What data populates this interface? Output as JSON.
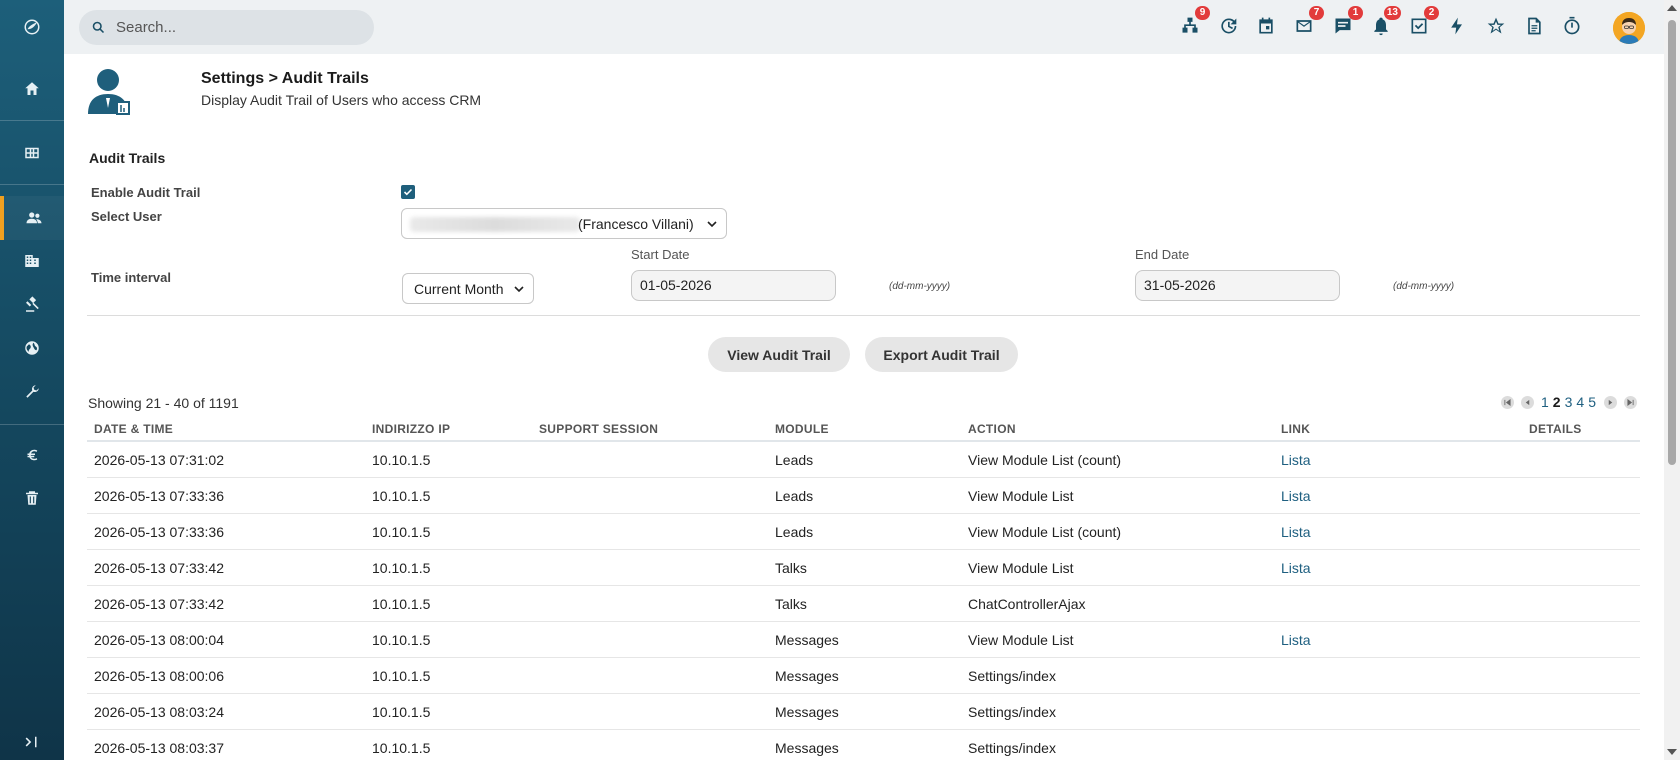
{
  "search": {
    "placeholder": "Search..."
  },
  "topbar": {
    "badges": {
      "structure": "9",
      "mail": "7",
      "chat": "1",
      "bell": "13",
      "tasks": "2"
    }
  },
  "page": {
    "title": "Settings > Audit Trails",
    "subtitle": "Display Audit Trail of Users who access CRM"
  },
  "form": {
    "section_title": "Audit Trails",
    "enable_label": "Enable Audit Trail",
    "enable_checked": true,
    "user_label": "Select User",
    "user_value": "(Francesco Villani)",
    "interval_label": "Time interval",
    "interval_value": "Current Month",
    "start_label": "Start Date",
    "start_value": "01-05-2026",
    "end_label": "End Date",
    "end_value": "31-05-2026",
    "date_format": "(dd-mm-yyyy)"
  },
  "buttons": {
    "view": "View Audit Trail",
    "export": "Export Audit Trail"
  },
  "pagination": {
    "showing": "Showing 21 - 40 of 1191",
    "pages": [
      "1",
      "2",
      "3",
      "4",
      "5"
    ],
    "current": "2"
  },
  "table": {
    "headers": {
      "date": "DATE & TIME",
      "ip": "INDIRIZZO IP",
      "support": "SUPPORT SESSION",
      "module": "MODULE",
      "action": "ACTION",
      "link": "LINK",
      "details": "DETAILS"
    },
    "rows": [
      {
        "date": "2026-05-13 07:31:02",
        "ip": "10.10.1.5",
        "module": "Leads",
        "action": "View Module List (count)",
        "link": "Lista"
      },
      {
        "date": "2026-05-13 07:33:36",
        "ip": "10.10.1.5",
        "module": "Leads",
        "action": "View Module List",
        "link": "Lista"
      },
      {
        "date": "2026-05-13 07:33:36",
        "ip": "10.10.1.5",
        "module": "Leads",
        "action": "View Module List (count)",
        "link": "Lista"
      },
      {
        "date": "2026-05-13 07:33:42",
        "ip": "10.10.1.5",
        "module": "Talks",
        "action": "View Module List",
        "link": "Lista"
      },
      {
        "date": "2026-05-13 07:33:42",
        "ip": "10.10.1.5",
        "module": "Talks",
        "action": "ChatControllerAjax",
        "link": ""
      },
      {
        "date": "2026-05-13 08:00:04",
        "ip": "10.10.1.5",
        "module": "Messages",
        "action": "View Module List",
        "link": "Lista"
      },
      {
        "date": "2026-05-13 08:00:06",
        "ip": "10.10.1.5",
        "module": "Messages",
        "action": "Settings/index",
        "link": ""
      },
      {
        "date": "2026-05-13 08:03:24",
        "ip": "10.10.1.5",
        "module": "Messages",
        "action": "Settings/index",
        "link": ""
      },
      {
        "date": "2026-05-13 08:03:37",
        "ip": "10.10.1.5",
        "module": "Messages",
        "action": "Settings/index",
        "link": ""
      }
    ]
  }
}
